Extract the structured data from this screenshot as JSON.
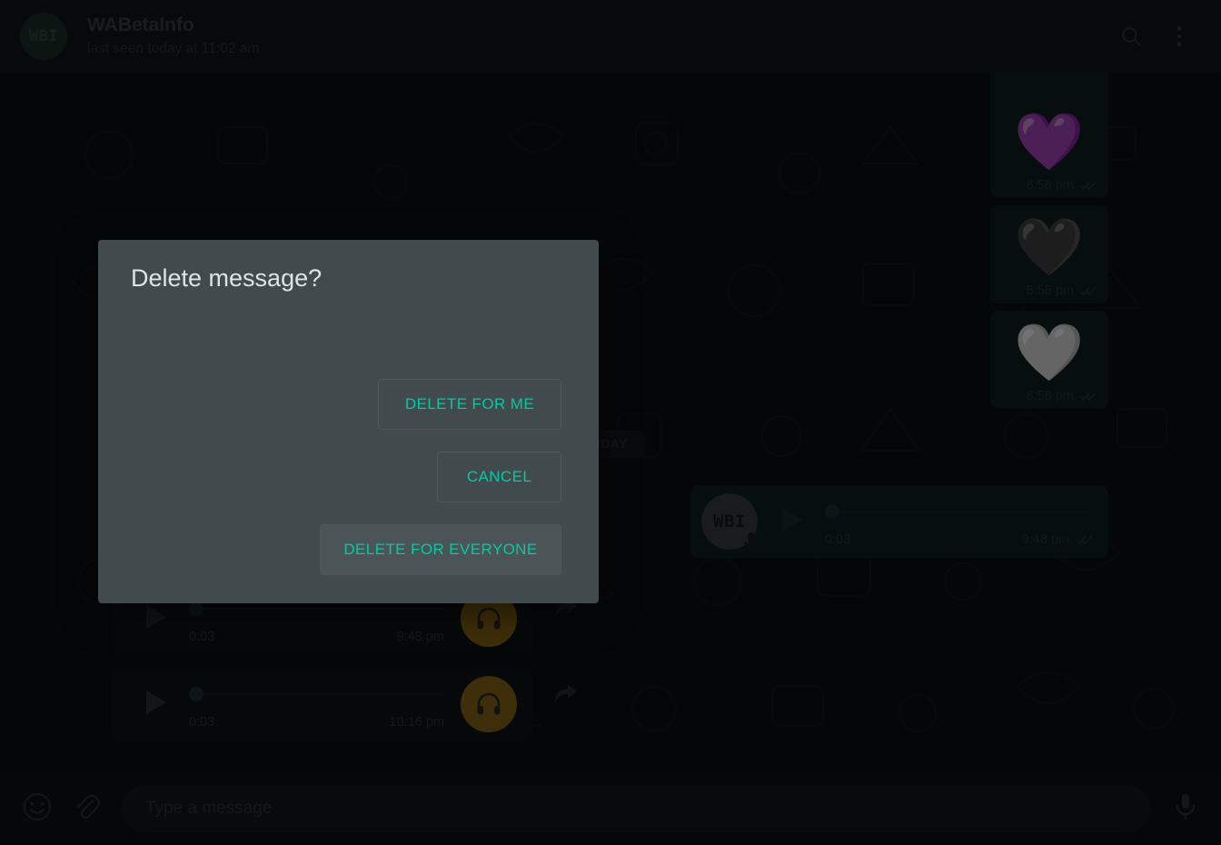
{
  "header": {
    "avatar_initials": "WBI",
    "title": "WABetaInfo",
    "status": "last seen today at 11:02 am",
    "search_icon": "search-icon",
    "menu_icon": "overflow-menu-icon"
  },
  "chat": {
    "date_divider": "YESTERDAY",
    "messages": [
      {
        "kind": "emoji",
        "emoji": "",
        "time": "8:58 pm",
        "status": "delivered",
        "direction": "out",
        "clipped": true
      },
      {
        "kind": "emoji",
        "emoji": "💜",
        "time": "8:58 pm",
        "status": "delivered",
        "direction": "out"
      },
      {
        "kind": "emoji",
        "emoji": "🖤",
        "time": "8:58 pm",
        "status": "delivered",
        "direction": "out"
      },
      {
        "kind": "emoji",
        "emoji": "🤍",
        "time": "8:58 pm",
        "status": "delivered",
        "direction": "out"
      },
      {
        "kind": "voice",
        "avatar": "WBI",
        "duration": "0:03",
        "time": "9:48 pm",
        "status": "delivered",
        "direction": "out"
      },
      {
        "kind": "voice",
        "avatar": "headphones",
        "duration": "0:03",
        "time": "9:48 pm",
        "direction": "in"
      },
      {
        "kind": "voice",
        "avatar": "headphones",
        "duration": "0:03",
        "time": "10:16 pm",
        "direction": "in"
      }
    ]
  },
  "composer": {
    "emoji_icon": "emoji-smiley-icon",
    "attach_icon": "paperclip-icon",
    "placeholder": "Type a message",
    "value": "",
    "mic_icon": "microphone-icon"
  },
  "dialog": {
    "title": "Delete message?",
    "buttons": [
      {
        "label": "DELETE FOR ME",
        "hovered": false
      },
      {
        "label": "CANCEL",
        "hovered": false
      },
      {
        "label": "DELETE FOR EVERYONE",
        "hovered": true
      }
    ]
  },
  "colors": {
    "accent": "#06c9a5",
    "dialog_bg": "#414a4c",
    "header_bg": "#101418",
    "chat_bg": "#0b1014",
    "bubble_out": "#0e1f1f",
    "bubble_in": "#0f1418",
    "headphone_avatar": "#8a6714"
  }
}
